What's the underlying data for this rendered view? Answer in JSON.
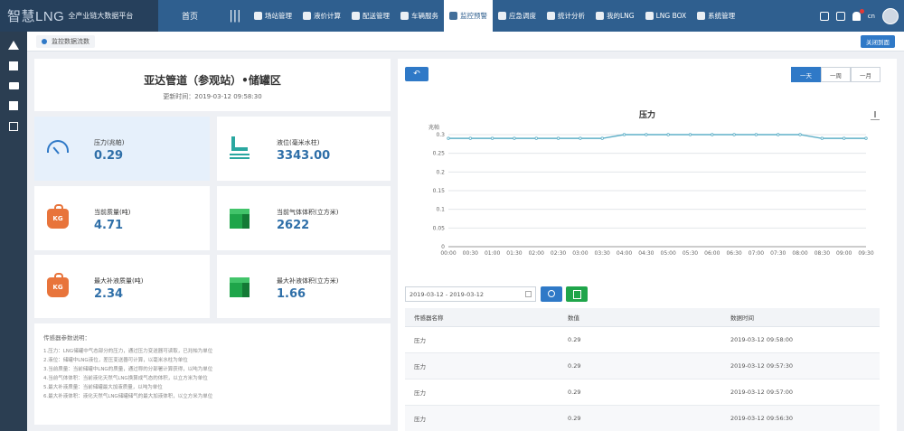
{
  "brand": {
    "logo": "智慧LNG",
    "subtitle": "全产业链大数据平台"
  },
  "nav": {
    "home": "首页",
    "items": [
      {
        "label": "场站管理",
        "icon": "station-icon"
      },
      {
        "label": "液价计算",
        "icon": "calculator-icon"
      },
      {
        "label": "配送管理",
        "icon": "delivery-icon"
      },
      {
        "label": "车辆服务",
        "icon": "vehicle-icon"
      },
      {
        "label": "监控预警",
        "icon": "monitor-icon",
        "active": true
      },
      {
        "label": "应急调度",
        "icon": "emergency-icon"
      },
      {
        "label": "统计分析",
        "icon": "stats-icon"
      },
      {
        "label": "我的LNG",
        "icon": "user-icon"
      },
      {
        "label": "LNG BOX",
        "icon": "box-icon"
      },
      {
        "label": "系统管理",
        "icon": "system-icon"
      }
    ],
    "lang": "cn"
  },
  "tabbar": {
    "tab_label": "监控数据流数",
    "close_all": "关闭到面"
  },
  "station": {
    "title": "亚达管道（参观站）•储罐区",
    "update_time": "更新时间：2019-03-12 09:58:30"
  },
  "metrics": [
    {
      "label": "压力(兆帕)",
      "value": "0.29",
      "icon": "gauge-icon"
    },
    {
      "label": "液位(毫米水柱)",
      "value": "3343.00",
      "icon": "tank-level-icon"
    },
    {
      "label": "当前质量(吨)",
      "value": "4.71",
      "icon": "weight-kg-icon"
    },
    {
      "label": "当前气体体积(立方米)",
      "value": "2622",
      "icon": "cube-icon"
    },
    {
      "label": "最大补液质量(吨)",
      "value": "2.34",
      "icon": "weight-kg-icon"
    },
    {
      "label": "最大补液体积(立方米)",
      "value": "1.66",
      "icon": "cube-icon"
    }
  ],
  "sensor_desc": {
    "heading": "传感器参数说明：",
    "lines": [
      "1.压力：LNG储罐中气态部分的压力，通过压力变送器可读取，已兆帕为单位",
      "2.液位：储罐中LNG液位，差压变送器可计算，以毫米水柱为单位",
      "3.当前质量：当前储罐中LNG的质量，通过称的分部署计算获得，以吨为单位",
      "4.当前气体体积：当前液化天然气LNG换算成气态的体积，以立方米为单位",
      "5.最大补液质量：当前储罐最大加液质量，以吨为单位",
      "6.最大补液体积：液化天然气LNG储罐储气的最大加液体积，以立方米为单位"
    ]
  },
  "range_buttons": [
    "一天",
    "一周",
    "一月"
  ],
  "chart_data": {
    "type": "line",
    "title": "压力",
    "ylabel": "兆帕",
    "ylim": [
      0,
      0.3
    ],
    "yticks": [
      "0",
      "0.05",
      "0.1",
      "0.15",
      "0.2",
      "0.25",
      "0.3"
    ],
    "categories": [
      "00:00",
      "00:30",
      "01:00",
      "01:30",
      "02:00",
      "02:30",
      "03:00",
      "03:30",
      "04:00",
      "04:30",
      "05:00",
      "05:30",
      "06:00",
      "06:30",
      "07:00",
      "07:30",
      "08:00",
      "08:30",
      "09:00",
      "09:30"
    ],
    "series": [
      {
        "values": [
          0.29,
          0.29,
          0.29,
          0.29,
          0.29,
          0.29,
          0.29,
          0.29,
          0.3,
          0.3,
          0.3,
          0.3,
          0.3,
          0.3,
          0.3,
          0.3,
          0.3,
          0.29,
          0.29,
          0.29
        ]
      }
    ],
    "line_color": "#5fb0c8",
    "grid": true
  },
  "filter": {
    "date_range": "2019-03-12 - 2019-03-12"
  },
  "table": {
    "headers": [
      "传感器名称",
      "数值",
      "数据时间"
    ],
    "rows": [
      [
        "压力",
        "0.29",
        "2019-03-12 09:58:00"
      ],
      [
        "压力",
        "0.29",
        "2019-03-12 09:57:30"
      ],
      [
        "压力",
        "0.29",
        "2019-03-12 09:57:00"
      ],
      [
        "压力",
        "0.29",
        "2019-03-12 09:56:30"
      ]
    ]
  }
}
